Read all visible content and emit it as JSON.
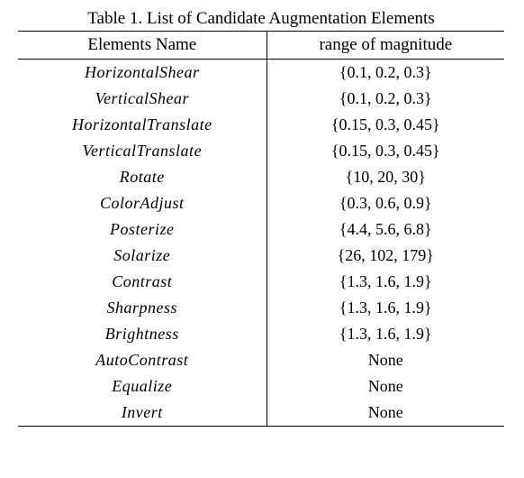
{
  "caption": "Table 1. List of Candidate Augmentation Elements",
  "headers": {
    "col1": "Elements Name",
    "col2": "range of magnitude"
  },
  "rows": [
    {
      "name": "HorizontalShear",
      "range": "{0.1, 0.2, 0.3}"
    },
    {
      "name": "VerticalShear",
      "range": "{0.1, 0.2, 0.3}"
    },
    {
      "name": "HorizontalTranslate",
      "range": "{0.15, 0.3, 0.45}"
    },
    {
      "name": "VerticalTranslate",
      "range": "{0.15, 0.3, 0.45}"
    },
    {
      "name": "Rotate",
      "range": "{10, 20, 30}"
    },
    {
      "name": "ColorAdjust",
      "range": "{0.3, 0.6, 0.9}"
    },
    {
      "name": "Posterize",
      "range": "{4.4, 5.6, 6.8}"
    },
    {
      "name": "Solarize",
      "range": "{26, 102, 179}"
    },
    {
      "name": "Contrast",
      "range": "{1.3, 1.6, 1.9}"
    },
    {
      "name": "Sharpness",
      "range": "{1.3, 1.6, 1.9}"
    },
    {
      "name": "Brightness",
      "range": "{1.3, 1.6, 1.9}"
    },
    {
      "name": "AutoContrast",
      "range": "None"
    },
    {
      "name": "Equalize",
      "range": "None"
    },
    {
      "name": "Invert",
      "range": "None"
    }
  ],
  "chart_data": {
    "type": "table",
    "title": "List of Candidate Augmentation Elements",
    "columns": [
      "Elements Name",
      "range of magnitude"
    ],
    "data": [
      [
        "HorizontalShear",
        [
          0.1,
          0.2,
          0.3
        ]
      ],
      [
        "VerticalShear",
        [
          0.1,
          0.2,
          0.3
        ]
      ],
      [
        "HorizontalTranslate",
        [
          0.15,
          0.3,
          0.45
        ]
      ],
      [
        "VerticalTranslate",
        [
          0.15,
          0.3,
          0.45
        ]
      ],
      [
        "Rotate",
        [
          10,
          20,
          30
        ]
      ],
      [
        "ColorAdjust",
        [
          0.3,
          0.6,
          0.9
        ]
      ],
      [
        "Posterize",
        [
          4.4,
          5.6,
          6.8
        ]
      ],
      [
        "Solarize",
        [
          26,
          102,
          179
        ]
      ],
      [
        "Contrast",
        [
          1.3,
          1.6,
          1.9
        ]
      ],
      [
        "Sharpness",
        [
          1.3,
          1.6,
          1.9
        ]
      ],
      [
        "Brightness",
        [
          1.3,
          1.6,
          1.9
        ]
      ],
      [
        "AutoContrast",
        null
      ],
      [
        "Equalize",
        null
      ],
      [
        "Invert",
        null
      ]
    ]
  }
}
